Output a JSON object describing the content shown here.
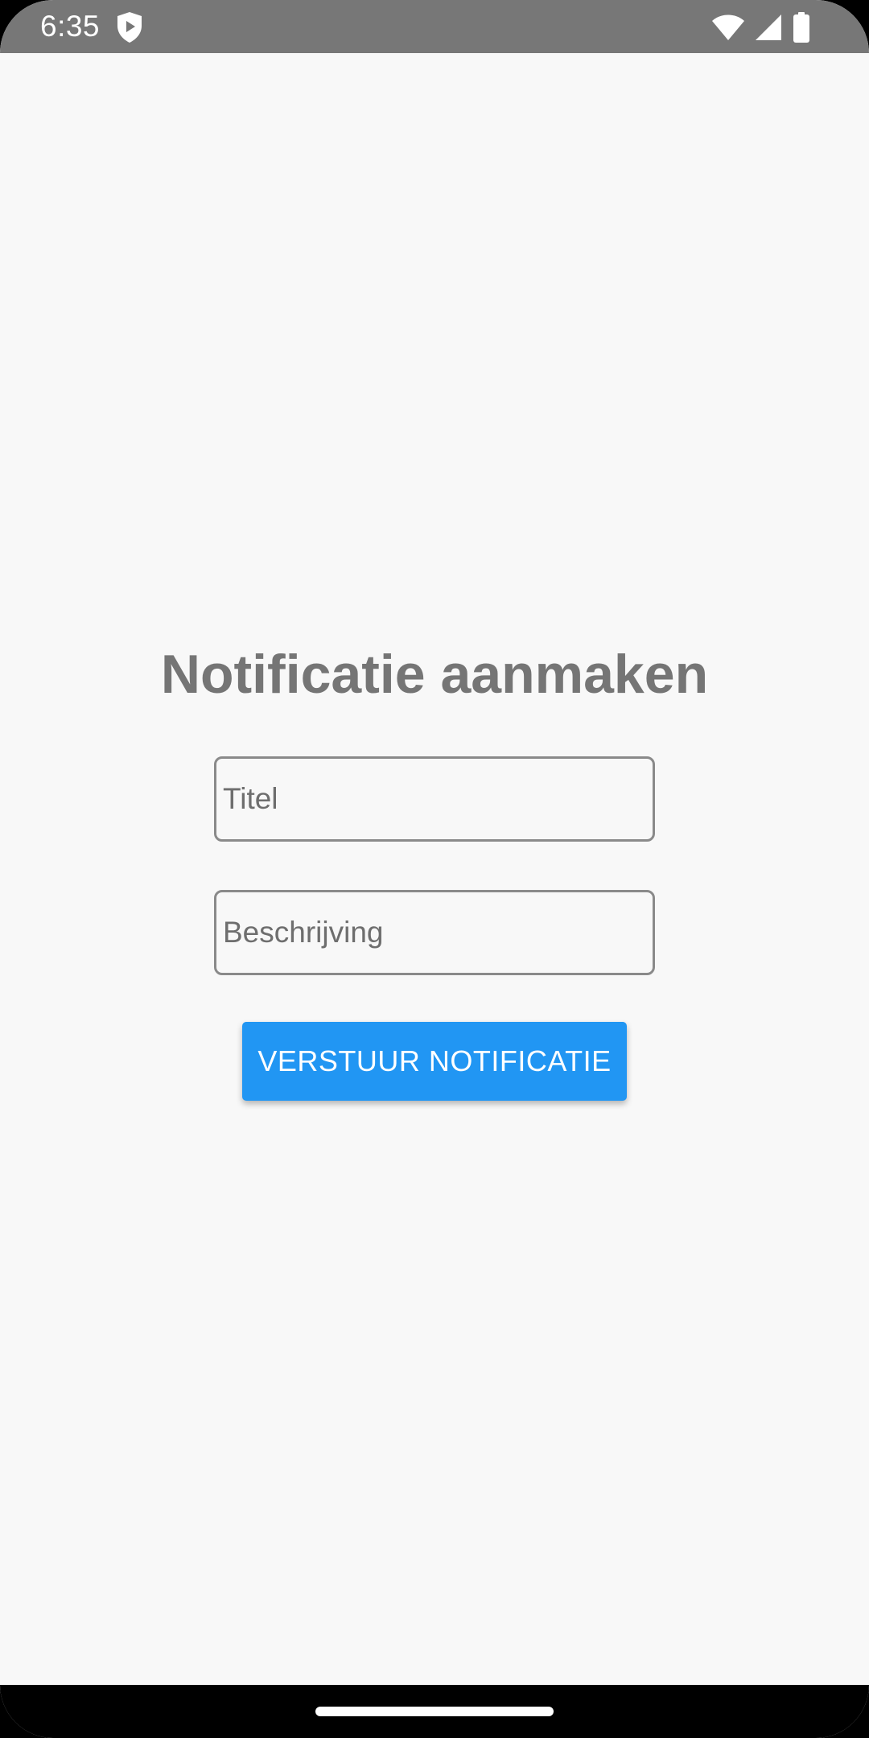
{
  "status_bar": {
    "time": "6:35",
    "icons": [
      "shield-play-icon",
      "wifi-icon",
      "cell-signal-icon",
      "battery-icon"
    ]
  },
  "main": {
    "title": "Notificatie aanmaken",
    "title_input": {
      "placeholder": "Titel",
      "value": ""
    },
    "description_input": {
      "placeholder": "Beschrijving",
      "value": ""
    },
    "send_button_label": "VERSTUUR NOTIFICATIE"
  },
  "colors": {
    "status_bar": "#777777",
    "background": "#f8f8f8",
    "title": "#757575",
    "button": "#2196f3",
    "nav_bar": "#000000"
  }
}
